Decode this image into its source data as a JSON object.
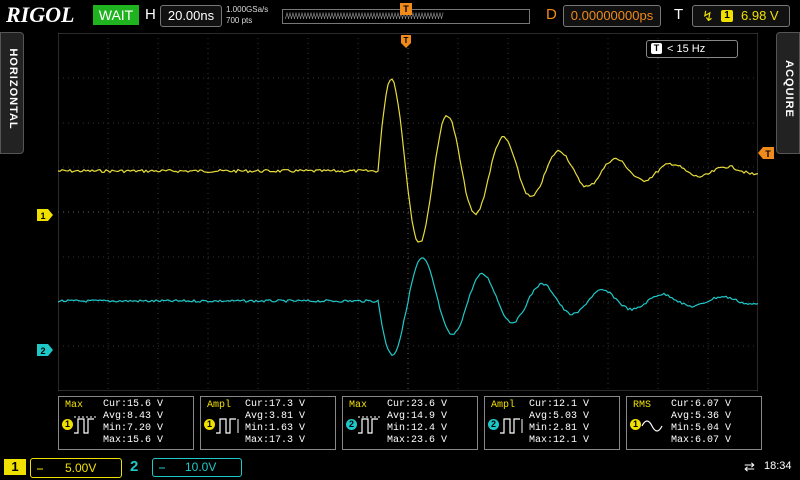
{
  "topbar": {
    "brand": "RIGOL",
    "run_status": "WAIT",
    "h_label": "H",
    "timebase": "20.00ns",
    "sample_rate": "1.000GSa/s",
    "memory_depth": "700 pts",
    "delay_label": "D",
    "delay": "0.00000000ps",
    "trigger_label": "T",
    "trigger_channel": "1",
    "trigger_level": "6.98 V",
    "trigger_marker": "T"
  },
  "side": {
    "left_menu": "HORIZONTAL",
    "right_menu": "ACQUIRE"
  },
  "bandwidth": {
    "chip": "T",
    "text": "< 15 Hz"
  },
  "markers": {
    "ch1": "1",
    "ch2": "2",
    "trigger_right": "T",
    "trigger_top": "T"
  },
  "measurements": [
    {
      "name": "Max",
      "channel": "1",
      "cur": "Cur:15.6 V",
      "avg": "Avg:8.43 V",
      "min": "Min:7.20 V",
      "max": "Max:15.6 V"
    },
    {
      "name": "Ampl",
      "channel": "1",
      "cur": "Cur:17.3 V",
      "avg": "Avg:3.81 V",
      "min": "Min:1.63 V",
      "max": "Max:17.3 V"
    },
    {
      "name": "Max",
      "channel": "2",
      "cur": "Cur:23.6 V",
      "avg": "Avg:14.9 V",
      "min": "Min:12.4 V",
      "max": "Max:23.6 V"
    },
    {
      "name": "Ampl",
      "channel": "2",
      "cur": "Cur:12.1 V",
      "avg": "Avg:5.03 V",
      "min": "Min:2.81 V",
      "max": "Max:12.1 V"
    },
    {
      "name": "RMS",
      "channel": "1",
      "cur": "Cur:6.07 V",
      "avg": "Avg:5.36 V",
      "min": "Min:5.04 V",
      "max": "Max:6.07 V"
    }
  ],
  "channels": {
    "ch1_label": "1",
    "ch1_scale": "5.00V",
    "ch2_label": "2",
    "ch2_scale": "10.0V"
  },
  "status": {
    "time": "18:34"
  },
  "colors": {
    "ch1": "#f0e000",
    "ch2": "#1fc8c8",
    "trigger": "#f08a1a",
    "run": "#1fb41f"
  }
}
